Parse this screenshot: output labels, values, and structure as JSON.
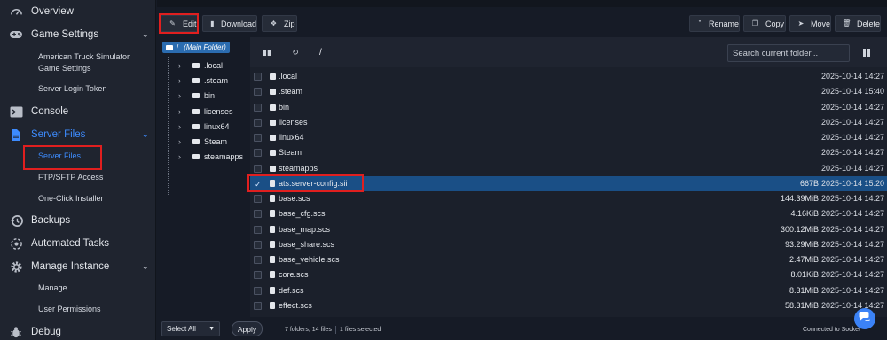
{
  "sidebar": {
    "items": [
      {
        "label": "Overview",
        "icon": "gauge-icon"
      },
      {
        "label": "Game Settings",
        "icon": "gamepad-icon",
        "expandable": true
      },
      {
        "label": "Console",
        "icon": "terminal-icon"
      },
      {
        "label": "Server Files",
        "icon": "file-icon",
        "expandable": true,
        "active": true
      },
      {
        "label": "Backups",
        "icon": "backup-icon"
      },
      {
        "label": "Automated Tasks",
        "icon": "tasks-icon"
      },
      {
        "label": "Manage Instance",
        "icon": "gear-icon",
        "expandable": true
      },
      {
        "label": "Debug",
        "icon": "bug-icon"
      }
    ],
    "game_settings_sub": [
      "American Truck Simulator",
      "Game Settings",
      "Server Login Token"
    ],
    "server_files_sub": [
      "Server Files",
      "FTP/SFTP Access",
      "One-Click Installer"
    ],
    "manage_sub": [
      "Manage",
      "User Permissions"
    ]
  },
  "toolbar": {
    "edit": "Edit",
    "download": "Download",
    "zip": "Zip",
    "rename": "Rename",
    "copy": "Copy",
    "move": "Move",
    "delete": "Delete"
  },
  "tree": {
    "root_slash": "/",
    "root_label": "(Main Folder)",
    "nodes": [
      ".local",
      ".steam",
      "bin",
      "licenses",
      "linux64",
      "Steam",
      "steamapps"
    ]
  },
  "files_header": {
    "path": "/",
    "search_placeholder": "Search current folder..."
  },
  "files": [
    {
      "name": ".local",
      "type": "folder",
      "size": "",
      "date": "2025-10-14 14:27"
    },
    {
      "name": ".steam",
      "type": "folder",
      "size": "",
      "date": "2025-10-14 15:40"
    },
    {
      "name": "bin",
      "type": "folder",
      "size": "",
      "date": "2025-10-14 14:27"
    },
    {
      "name": "licenses",
      "type": "folder",
      "size": "",
      "date": "2025-10-14 14:27"
    },
    {
      "name": "linux64",
      "type": "folder",
      "size": "",
      "date": "2025-10-14 14:27"
    },
    {
      "name": "Steam",
      "type": "folder",
      "size": "",
      "date": "2025-10-14 14:27"
    },
    {
      "name": "steamapps",
      "type": "folder",
      "size": "",
      "date": "2025-10-14 14:27"
    },
    {
      "name": "ats.server-config.sii",
      "type": "file",
      "size": "667B",
      "date": "2025-10-14 15:20",
      "selected": true
    },
    {
      "name": "base.scs",
      "type": "file",
      "size": "144.39MiB",
      "date": "2025-10-14 14:27"
    },
    {
      "name": "base_cfg.scs",
      "type": "file",
      "size": "4.16KiB",
      "date": "2025-10-14 14:27"
    },
    {
      "name": "base_map.scs",
      "type": "file",
      "size": "300.12MiB",
      "date": "2025-10-14 14:27"
    },
    {
      "name": "base_share.scs",
      "type": "file",
      "size": "93.29MiB",
      "date": "2025-10-14 14:27"
    },
    {
      "name": "base_vehicle.scs",
      "type": "file",
      "size": "2.47MiB",
      "date": "2025-10-14 14:27"
    },
    {
      "name": "core.scs",
      "type": "file",
      "size": "8.01KiB",
      "date": "2025-10-14 14:27"
    },
    {
      "name": "def.scs",
      "type": "file",
      "size": "8.31MiB",
      "date": "2025-10-14 14:27"
    },
    {
      "name": "effect.scs",
      "type": "file",
      "size": "58.31MiB",
      "date": "2025-10-14 14:27"
    }
  ],
  "bottom": {
    "select_all": "Select All",
    "apply": "Apply",
    "counts": "7 folders, 14 files",
    "selected": "1 files selected",
    "connection": "Connected to Socket"
  },
  "colors": {
    "accent": "#3d8bfd",
    "highlight_box": "#e01f1f",
    "selected_row": "#1a4f86"
  }
}
